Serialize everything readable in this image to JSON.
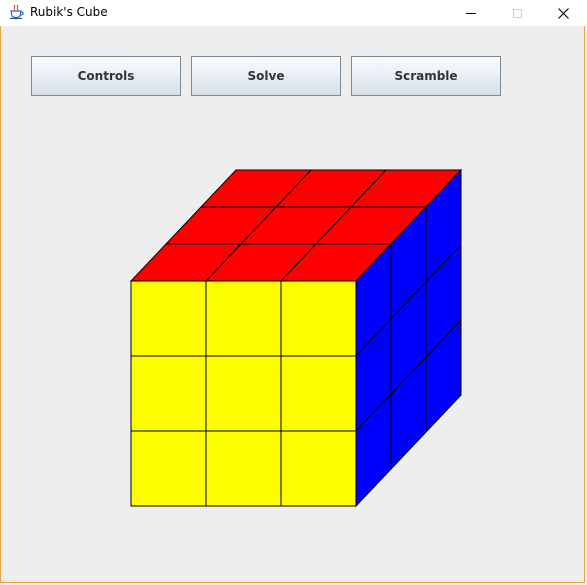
{
  "window": {
    "title": "Rubik's Cube"
  },
  "toolbar": {
    "controls_label": "Controls",
    "solve_label": "Solve",
    "scramble_label": "Scramble"
  },
  "cube": {
    "top_face_color": "#ff0000",
    "front_face_color": "#ffff00",
    "right_face_color": "#0000ff",
    "edge_color": "#000000"
  },
  "colors": {
    "background": "#eeeeee",
    "window_border": "#e3a447"
  },
  "icons": {
    "app": "java-cup-icon",
    "minimize": "minimize-icon",
    "maximize": "maximize-icon",
    "close": "close-icon"
  }
}
